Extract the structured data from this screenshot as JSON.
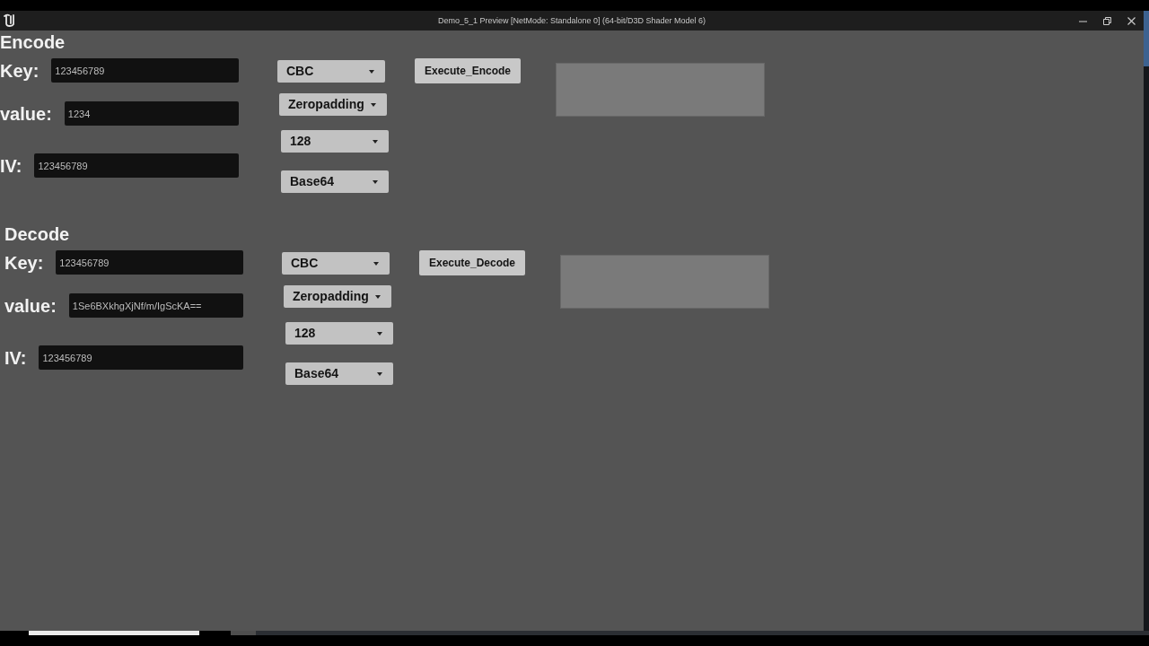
{
  "window": {
    "title": "Demo_5_1 Preview [NetMode: Standalone 0] (64-bit/D3D Shader Model 6)"
  },
  "sections": [
    {
      "heading": "Encode",
      "fields": [
        {
          "label": "Key:",
          "value": "123456789"
        },
        {
          "label": "value:",
          "value": "1234"
        },
        {
          "label": "IV:",
          "value": "123456789"
        }
      ],
      "dropdowns": [
        "CBC",
        "Zeropadding",
        "128",
        "Base64"
      ],
      "button": "Execute_Encode"
    },
    {
      "heading": "Decode",
      "fields": [
        {
          "label": "Key:",
          "value": "123456789"
        },
        {
          "label": "value:",
          "value": "1Se6BXkhgXjNf/m/IgScKA=="
        },
        {
          "label": "IV:",
          "value": "123456789"
        }
      ],
      "dropdowns": [
        "CBC",
        "Zeropadding",
        "128",
        "Base64"
      ],
      "button": "Execute_Decode"
    }
  ]
}
